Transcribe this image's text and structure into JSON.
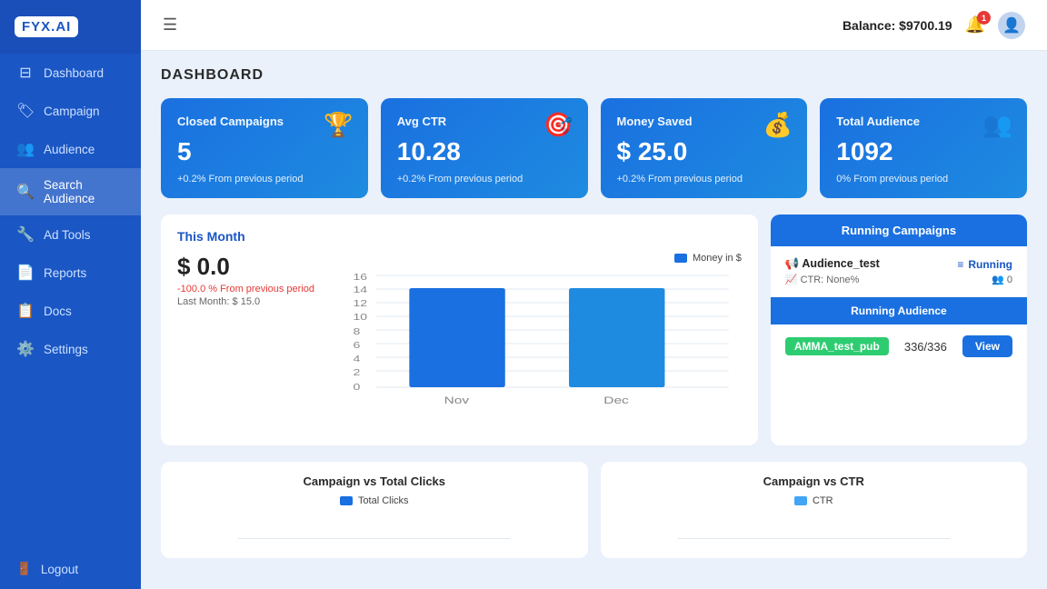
{
  "sidebar": {
    "logo": "FYX.AI",
    "items": [
      {
        "id": "dashboard",
        "label": "Dashboard",
        "icon": "⊟",
        "active": true
      },
      {
        "id": "campaign",
        "label": "Campaign",
        "icon": "🏷️",
        "active": false
      },
      {
        "id": "audience",
        "label": "Audience",
        "icon": "👥",
        "active": false
      },
      {
        "id": "search-audience",
        "label": "Search Audience",
        "icon": "🔍",
        "active": true
      },
      {
        "id": "ad-tools",
        "label": "Ad Tools",
        "icon": "🔧",
        "active": false
      },
      {
        "id": "reports",
        "label": "Reports",
        "icon": "📄",
        "active": false
      },
      {
        "id": "docs",
        "label": "Docs",
        "icon": "📋",
        "active": false
      },
      {
        "id": "settings",
        "label": "Settings",
        "icon": "⚙️",
        "active": false
      }
    ],
    "logout_label": "Logout"
  },
  "header": {
    "hamburger_icon": "☰",
    "balance_label": "Balance: $9700.19",
    "bell_badge": "1",
    "avatar_icon": "👤"
  },
  "page": {
    "title": "DASHBOARD"
  },
  "stat_cards": [
    {
      "title": "Closed Campaigns",
      "value": "5",
      "change": "+0.2% From previous period",
      "icon": "🏆"
    },
    {
      "title": "Avg CTR",
      "value": "10.28",
      "change": "+0.2% From previous period",
      "icon": "🎯"
    },
    {
      "title": "Money Saved",
      "value": "$ 25.0",
      "change": "+0.2% From previous period",
      "icon": "💰"
    },
    {
      "title": "Total Audience",
      "value": "1092",
      "change": "0% From previous period",
      "icon": "👥"
    }
  ],
  "this_month": {
    "title": "This Month",
    "amount": "$ 0.0",
    "change": "-100.0 % From previous period",
    "last_month": "Last Month: $ 15.0",
    "legend": "Money in $",
    "chart": {
      "bars": [
        {
          "label": "Nov",
          "value": 14
        },
        {
          "label": "Dec",
          "value": 14
        }
      ],
      "max": 16
    }
  },
  "running_campaigns": {
    "title": "Running Campaigns",
    "campaign": {
      "name": "Audience_test",
      "ctr": "CTR: None%",
      "status": "Running",
      "count": "0"
    },
    "audience_section": {
      "title": "Running Audience",
      "tag": "AMMA_test_pub",
      "count": "336/336",
      "view_button": "View"
    }
  },
  "bottom_charts": [
    {
      "title": "Campaign vs Total Clicks",
      "legend": "Total Clicks"
    },
    {
      "title": "Campaign vs CTR",
      "legend": "CTR"
    }
  ]
}
